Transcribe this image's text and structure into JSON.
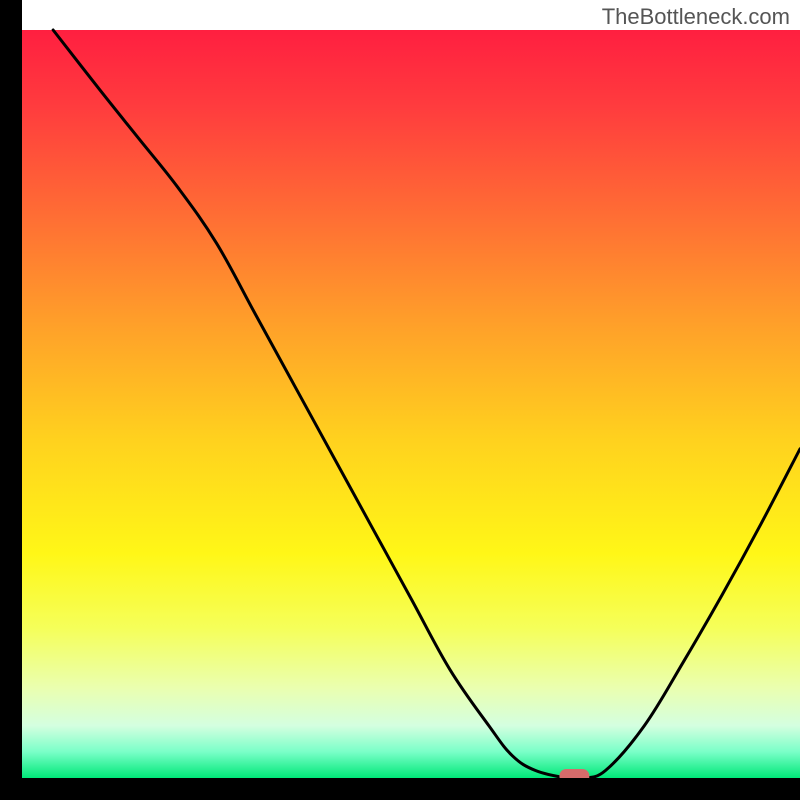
{
  "watermark": "TheBottleneck.com",
  "chart_data": {
    "type": "line",
    "title": "",
    "xlabel": "",
    "ylabel": "",
    "xlim": [
      0,
      100
    ],
    "ylim": [
      0,
      100
    ],
    "grid": false,
    "legend": false,
    "series": [
      {
        "name": "curve",
        "x": [
          4,
          10,
          15,
          20,
          25,
          30,
          35,
          40,
          45,
          50,
          55,
          60,
          63,
          66,
          70,
          72,
          75,
          80,
          85,
          90,
          95,
          100
        ],
        "values": [
          100,
          92,
          85.5,
          79,
          71.5,
          62,
          52.5,
          43,
          33.5,
          24,
          14.5,
          7,
          3,
          1,
          0,
          0,
          1,
          7,
          15.5,
          24.5,
          34,
          44
        ]
      }
    ],
    "marker": {
      "x": 71,
      "y": 0,
      "color": "#d66b6b"
    },
    "background_gradient": {
      "stops": [
        {
          "offset": 0.0,
          "color": "#ff1f40"
        },
        {
          "offset": 0.1,
          "color": "#ff3b3e"
        },
        {
          "offset": 0.25,
          "color": "#ff6e34"
        },
        {
          "offset": 0.4,
          "color": "#ffa229"
        },
        {
          "offset": 0.55,
          "color": "#ffd21e"
        },
        {
          "offset": 0.7,
          "color": "#fff717"
        },
        {
          "offset": 0.8,
          "color": "#f5ff5a"
        },
        {
          "offset": 0.88,
          "color": "#eaffb0"
        },
        {
          "offset": 0.93,
          "color": "#d4ffe0"
        },
        {
          "offset": 0.965,
          "color": "#7affc8"
        },
        {
          "offset": 1.0,
          "color": "#00e878"
        }
      ]
    },
    "axes_color": "#000000",
    "curve_color": "#000000"
  }
}
